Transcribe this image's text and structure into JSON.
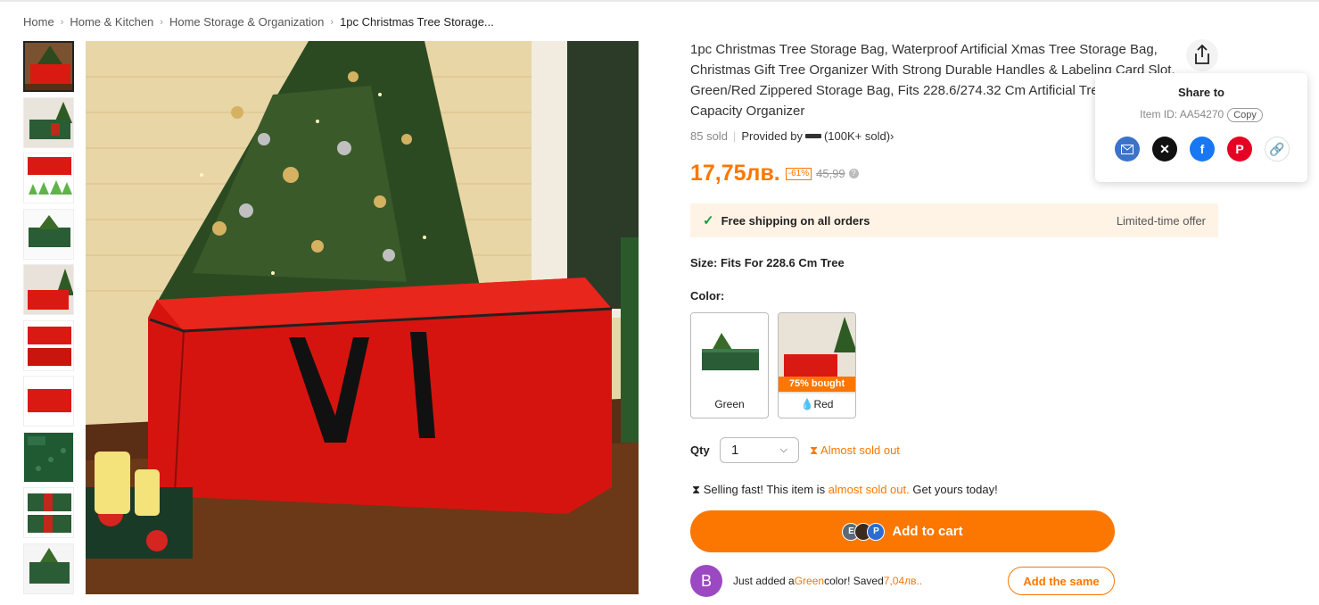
{
  "breadcrumb": [
    "Home",
    "Home & Kitchen",
    "Home Storage & Organization",
    "1pc Christmas Tree Storage..."
  ],
  "product": {
    "title": "1pc Christmas Tree Storage Bag, Waterproof Artificial Xmas Tree Storage Bag, Christmas Gift Tree Organizer With Strong Durable Handles & Labeling Card Slot, Green/Red Zippered Storage Bag, Fits 228.6/274.32 Cm Artificial Tree, Large Capacity Organizer",
    "sold": "85 sold",
    "provided_by": "Provided by",
    "provider_sold": "(100K+ sold)",
    "price": "17,75лв.",
    "discount": "-61%",
    "old_price": "45,99",
    "price_info_icon": "?"
  },
  "shipping": {
    "check": "✓",
    "text": "Free shipping on all orders",
    "offer": "Limited-time offer"
  },
  "size": {
    "label": "Size:",
    "value": "Fits For 228.6 Cm Tree"
  },
  "color": {
    "label": "Color:",
    "options": [
      {
        "name": "Green",
        "badge": ""
      },
      {
        "name": "Red",
        "badge": "75% bought",
        "icon": "fire-icon"
      }
    ]
  },
  "qty": {
    "label": "Qty",
    "value": "1",
    "stock": "Almost sold out"
  },
  "selling": {
    "pre": "Selling fast! This item is ",
    "hl": "almost sold out.",
    "post": " Get yours today!"
  },
  "cart": {
    "label": "Add to cart",
    "avatars": [
      "E",
      "",
      "P"
    ]
  },
  "just_added": {
    "avatar": "B",
    "pre": "Just added a ",
    "color": "Green",
    "mid": " color! Saved ",
    "amount": "7,04лв..",
    "button": "Add the same"
  },
  "share": {
    "title": "Share to",
    "item_id": "Item ID: AA54270",
    "copy": "Copy",
    "icons": [
      "email-icon",
      "x-icon",
      "facebook-icon",
      "pinterest-icon",
      "link-icon"
    ]
  },
  "colors": {
    "accent": "#fb7701",
    "ship_bg": "#fff3e6",
    "check": "#1a9b3d"
  }
}
